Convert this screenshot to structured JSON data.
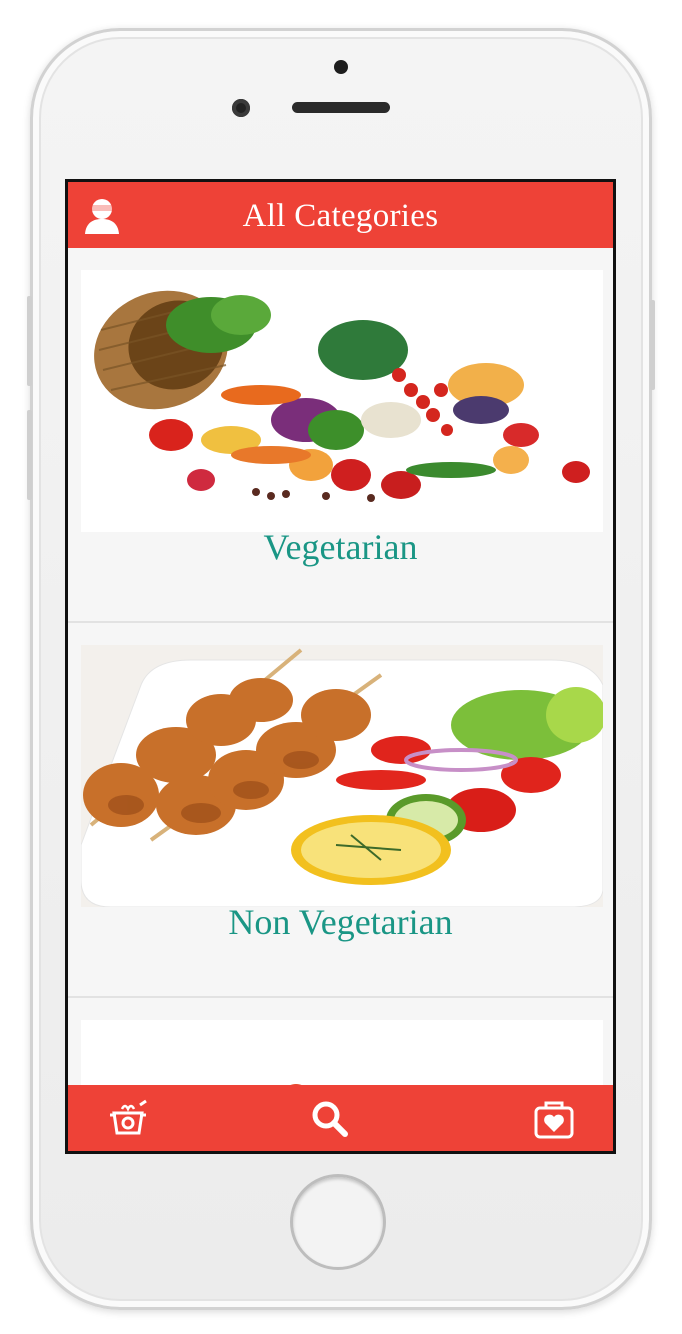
{
  "header": {
    "title": "All Categories",
    "profile_icon": "user-icon"
  },
  "categories": [
    {
      "label": "Vegetarian",
      "image": "vegetables-basket-image"
    },
    {
      "label": "Non Vegetarian",
      "image": "chicken-skewers-image"
    }
  ],
  "bottom_nav": {
    "items": [
      {
        "icon": "cooking-pot-icon"
      },
      {
        "icon": "search-icon"
      },
      {
        "icon": "favorites-bag-icon"
      }
    ]
  },
  "colors": {
    "accent": "#ee4237",
    "label_teal": "#1a9685"
  }
}
